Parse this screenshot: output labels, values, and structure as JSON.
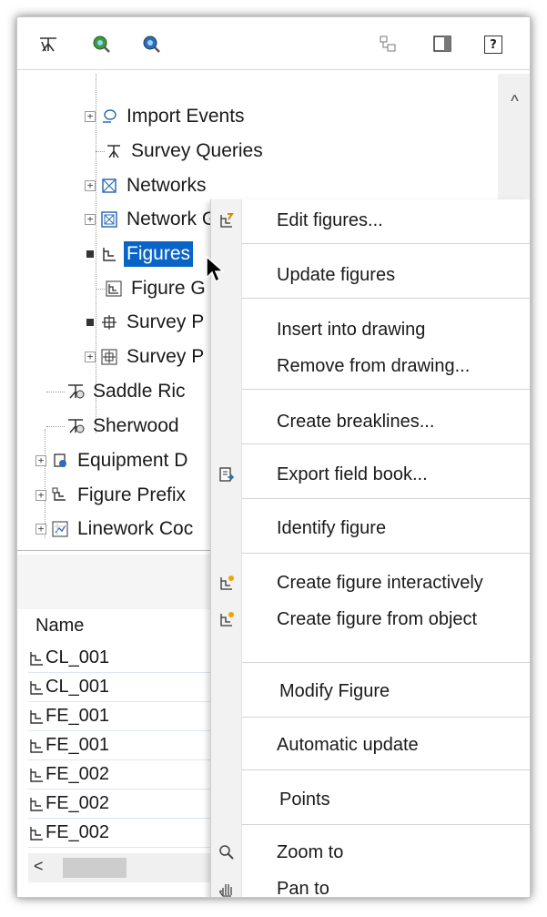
{
  "toolbar": {
    "icons": [
      "survey-network-icon",
      "query-icon",
      "settings-query-icon",
      "layout-icon",
      "panel-icon",
      "help-icon"
    ],
    "help_label": "?"
  },
  "tree": {
    "import_events": "Import Events",
    "survey_queries": "Survey Queries",
    "networks": "Networks",
    "network_groups": "Network G",
    "figures": "Figures",
    "figure_groups": "Figure G",
    "survey_points": "Survey P",
    "survey_point_groups": "Survey P",
    "saddle_ridge": "Saddle Ric",
    "sherwood": "Sherwood",
    "equipment": "Equipment D",
    "figure_prefix": "Figure Prefix",
    "linework_code": "Linework Coc"
  },
  "list": {
    "column_name": "Name",
    "rows": [
      "CL_001",
      "CL_001",
      "FE_001",
      "FE_001",
      "FE_002",
      "FE_002",
      "FE_002"
    ],
    "scroll_left": "<"
  },
  "context_menu": {
    "edit_figures": "Edit figures...",
    "update_figures": "Update figures",
    "insert_into_drawing": "Insert into drawing",
    "remove_from_drawing": "Remove from drawing...",
    "create_breaklines": "Create breaklines...",
    "export_field_book": "Export field book...",
    "identify_figure": "Identify figure",
    "create_figure_interactively": "Create figure interactively",
    "create_figure_from_object": "Create figure from object",
    "modify_figure": "Modify Figure",
    "automatic_update": "Automatic update",
    "points": "Points",
    "zoom_to": "Zoom to",
    "pan_to": "Pan to"
  },
  "colors": {
    "selection": "#0a64c8",
    "menu_gutter": "#f2f2f2"
  }
}
